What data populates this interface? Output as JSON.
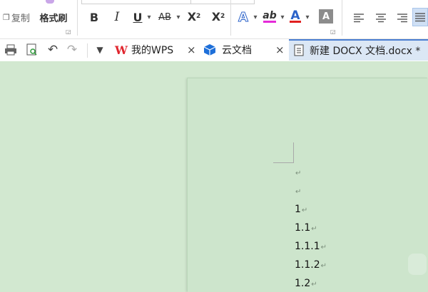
{
  "ribbon": {
    "copy_label": "复制",
    "format_painter_label": "格式刷",
    "bold": "B",
    "italic": "I",
    "underline": "U",
    "strikethrough": "AB",
    "superscript_base": "X",
    "superscript_mark": "2",
    "subscript_base": "X",
    "subscript_mark": "2",
    "text_effect": "A",
    "highlight": "ab",
    "font_color": "A",
    "char_shading": "A",
    "dropdown_caret": "▾",
    "highlight_color": "#e52ad8",
    "font_color_accent": "#e02020"
  },
  "tabs": [
    {
      "label": "我的WPS",
      "close": "×"
    },
    {
      "label": "云文档",
      "close": "×"
    },
    {
      "label": "新建 DOCX 文档.docx *",
      "close": ""
    }
  ],
  "document": {
    "paragraph_mark": "↵",
    "lines": [
      "",
      "",
      "1",
      "1.1",
      "1.1.1",
      "1.1.2",
      "1.2"
    ]
  },
  "colors": {
    "doc_background": "#d2e8d0",
    "wps_red": "#e0262e",
    "cloud_blue": "#1e6fd9"
  }
}
